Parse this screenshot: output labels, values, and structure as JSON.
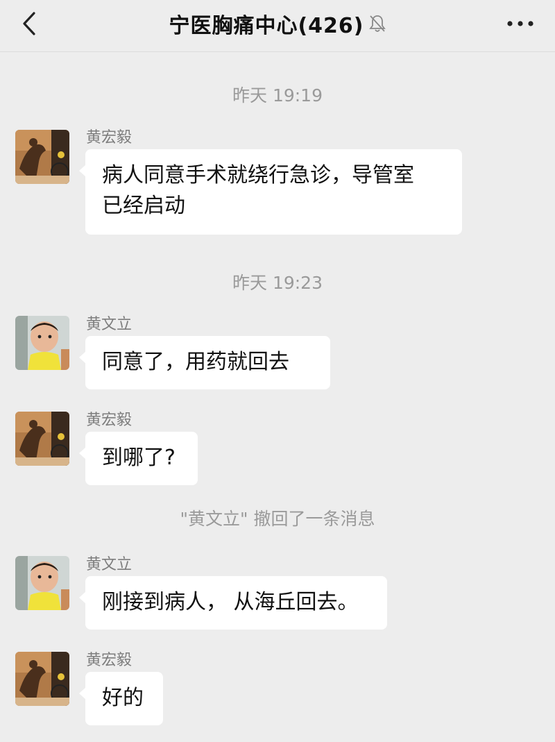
{
  "header": {
    "title": "宁医胸痛中心(426)",
    "back_icon": "chevron-left-icon",
    "mute_icon": "bell-off-icon",
    "more_icon": "more-dots-icon"
  },
  "messages": [
    {
      "type": "time",
      "text": "昨天 19:19"
    },
    {
      "type": "msg",
      "sender": "黄宏毅",
      "avatar": "avatar-huang-hongyi",
      "lines": [
        "病人同意手术就绕行急诊，导管室",
        "已经启动"
      ]
    },
    {
      "type": "time",
      "text": "昨天 19:23"
    },
    {
      "type": "msg",
      "sender": "黄文立",
      "avatar": "avatar-huang-wenli",
      "lines": [
        "同意了，用药就回去"
      ]
    },
    {
      "type": "msg",
      "sender": "黄宏毅",
      "avatar": "avatar-huang-hongyi",
      "lines": [
        "到哪了?"
      ]
    },
    {
      "type": "recall",
      "text": "\"黄文立\" 撤回了一条消息"
    },
    {
      "type": "msg",
      "sender": "黄文立",
      "avatar": "avatar-huang-wenli",
      "lines": [
        "刚接到病人， 从海丘回去。"
      ]
    },
    {
      "type": "msg",
      "sender": "黄宏毅",
      "avatar": "avatar-huang-hongyi",
      "lines": [
        "好的"
      ]
    }
  ],
  "colors": {
    "background": "#ededed",
    "bubble": "#ffffff",
    "meta_text": "#9a9a9a"
  }
}
